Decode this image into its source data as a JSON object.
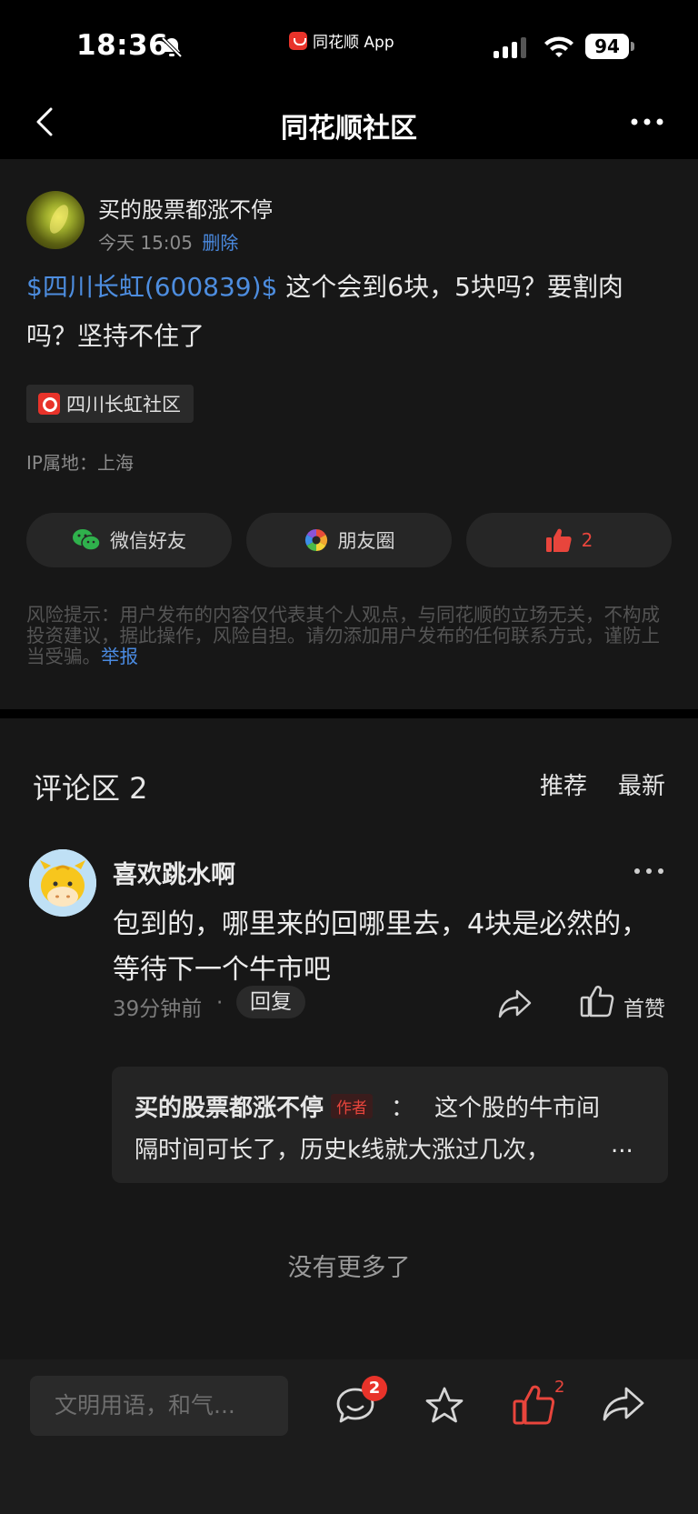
{
  "status_bar": {
    "time": "18:36",
    "origin_app": "同花顺 App",
    "battery": "94"
  },
  "nav": {
    "title": "同花顺社区",
    "back_icon": "chevron-left-icon",
    "more_icon": "more-dots-icon"
  },
  "post": {
    "author": "买的股票都涨不停",
    "time": "今天 15:05",
    "delete_label": "删除",
    "stock_link": "$四川长虹(600839)$",
    "body": " 这个会到6块，5块吗？要割肉吗？坚持不住了",
    "community_tag": "四川长虹社区",
    "ip_location": "IP属地：上海",
    "share_wechat": "微信好友",
    "share_moments": "朋友圈",
    "like_count": "2",
    "risk_notice": "风险提示：用户发布的内容仅代表其个人观点，与同花顺的立场无关，不构成投资建议，据此操作，风险自担。请勿添加用户发布的任何联系方式，谨防上当受骗。",
    "report_label": "举报"
  },
  "comments": {
    "section_title": "评论区 2",
    "sort_recommend": "推荐",
    "sort_latest": "最新",
    "items": [
      {
        "author": "喜欢跳水啊",
        "text": "包到的，哪里来的回哪里去，4块是必然的，等待下一个牛市吧",
        "time": "39分钟前",
        "dot": "·",
        "reply_label": "回复",
        "like_label": "首赞",
        "reply": {
          "author": "买的股票都涨不停",
          "badge": "作者",
          "colon": "：",
          "text_line1": "这个股的牛市间",
          "text_line2": "隔时间可长了，历史k线就大涨过几次，",
          "ellipsis": "..."
        }
      }
    ],
    "no_more": "没有更多了"
  },
  "bottom_bar": {
    "input_placeholder": "文明用语，和气...",
    "comment_badge": "2",
    "like_count": "2"
  },
  "colors": {
    "accent_blue": "#4a8ae0",
    "accent_red": "#e8453c",
    "background": "#171717"
  }
}
